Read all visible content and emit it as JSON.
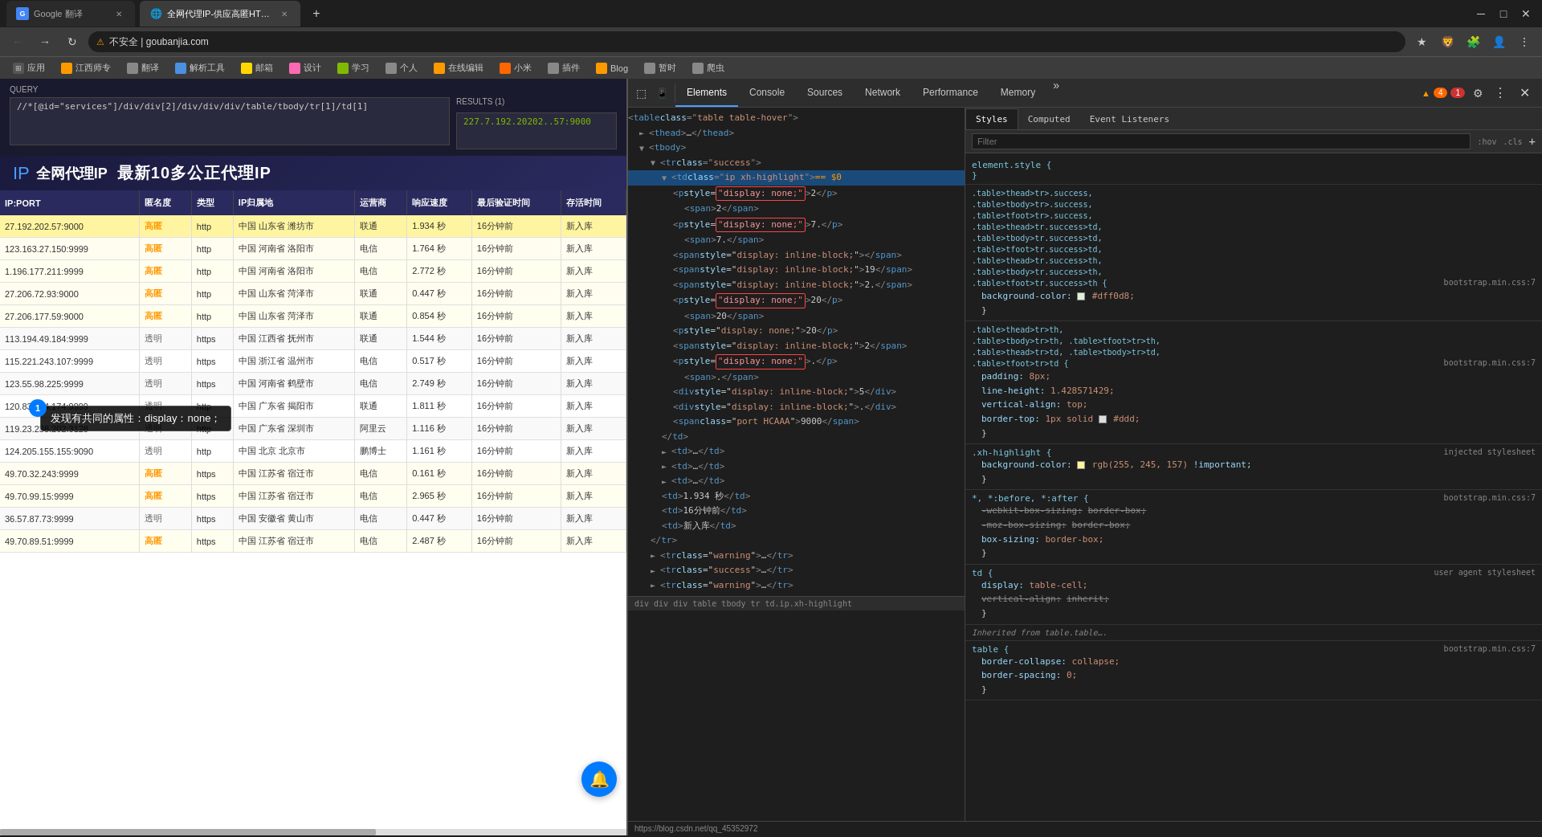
{
  "browser": {
    "tabs": [
      {
        "id": "tab1",
        "title": "Google 翻译",
        "active": false,
        "favicon": "G"
      },
      {
        "id": "tab2",
        "title": "全网代理IP-供应高匿HTTP代理...",
        "active": true,
        "favicon": "🌐"
      }
    ],
    "address": "不安全 | goubanjia.com",
    "bookmarks": [
      "应用",
      "江西师专",
      "翻译",
      "解析工具",
      "邮箱",
      "设计",
      "学习",
      "个人",
      "在线编辑",
      "小米",
      "插件",
      "Blog",
      "暂时",
      "爬虫"
    ]
  },
  "query": {
    "label": "QUERY",
    "input": "//*[@id=\"services\"]/div/div[2]/div/div/div/table/tbody/tr[1]/td[1]",
    "results_label": "RESULTS (1)",
    "result_value": "227.7.192.20202..57:9000"
  },
  "page": {
    "logo": "全网代理IP",
    "title": "最新10多公正代理IP"
  },
  "table": {
    "headers": [
      "IP:PORT",
      "匿名度",
      "类型",
      "IP归属地",
      "运营商",
      "响应速度",
      "最后验证时间",
      "存活时间"
    ],
    "rows": [
      {
        "ip": "27.192.202.57:9000",
        "anon": "高匿",
        "type": "http",
        "location": "中国 山东省 潍坊市",
        "isp": "联通",
        "speed": "1.934 秒",
        "time": "16分钟前",
        "alive": "新入库",
        "highlight": true
      },
      {
        "ip": "123.163.27.150:9999",
        "anon": "高匿",
        "type": "http",
        "location": "中国 河南省 洛阳市",
        "isp": "电信",
        "speed": "1.764 秒",
        "time": "16分钟前",
        "alive": "新入库",
        "highlight": false
      },
      {
        "ip": "1.196.177.211:9999",
        "anon": "高匿",
        "type": "http",
        "location": "中国 河南省 洛阳市",
        "isp": "电信",
        "speed": "2.772 秒",
        "time": "16分钟前",
        "alive": "新入库",
        "highlight": false
      },
      {
        "ip": "27.206.72.93:9000",
        "anon": "高匿",
        "type": "http",
        "location": "中国 山东省 菏泽市",
        "isp": "联通",
        "speed": "0.447 秒",
        "time": "16分钟前",
        "alive": "新入库",
        "highlight": false
      },
      {
        "ip": "27.206.177.59:9000",
        "anon": "高匿",
        "type": "http",
        "location": "中国 山东省 菏泽市",
        "isp": "联通",
        "speed": "0.854 秒",
        "time": "16分钟前",
        "alive": "新入库",
        "highlight": false
      },
      {
        "ip": "113.194.49.184:9999",
        "anon": "透明",
        "type": "https",
        "location": "中国 江西省 抚州市",
        "isp": "联通",
        "speed": "1.544 秒",
        "time": "16分钟前",
        "alive": "新入库",
        "highlight": false
      },
      {
        "ip": "115.221.243.107:9999",
        "anon": "透明",
        "type": "https",
        "location": "中国 浙江省 温州市",
        "isp": "电信",
        "speed": "0.517 秒",
        "time": "16分钟前",
        "alive": "新入库",
        "highlight": false
      },
      {
        "ip": "123.55.98.225:9999",
        "anon": "透明",
        "type": "https",
        "location": "中国 河南省 鹤壁市",
        "isp": "电信",
        "speed": "2.749 秒",
        "time": "16分钟前",
        "alive": "新入库",
        "highlight": false
      },
      {
        "ip": "120.83.104.174:9999",
        "anon": "透明",
        "type": "http",
        "location": "中国 广东省 揭阳市",
        "isp": "联通",
        "speed": "1.811 秒",
        "time": "16分钟前",
        "alive": "新入库",
        "highlight": false
      },
      {
        "ip": "119.23.238.202:3128",
        "anon": "透明",
        "type": "http",
        "location": "中国 广东省 深圳市",
        "isp": "阿里云",
        "speed": "1.116 秒",
        "time": "16分钟前",
        "alive": "新入库",
        "highlight": false
      },
      {
        "ip": "124.205.155.155:9090",
        "anon": "透明",
        "type": "http",
        "location": "中国 北京 北京市",
        "isp": "鹏博士",
        "speed": "1.161 秒",
        "time": "16分钟前",
        "alive": "新入库",
        "highlight": false
      },
      {
        "ip": "49.70.32.243:9999",
        "anon": "高匿",
        "type": "https",
        "location": "中国 江苏省 宿迁市",
        "isp": "电信",
        "speed": "0.161 秒",
        "time": "16分钟前",
        "alive": "新入库",
        "highlight": false
      },
      {
        "ip": "49.70.99.15:9999",
        "anon": "高匿",
        "type": "https",
        "location": "中国 江苏省 宿迁市",
        "isp": "电信",
        "speed": "2.965 秒",
        "time": "16分钟前",
        "alive": "新入库",
        "highlight": false
      },
      {
        "ip": "36.57.87.73:9999",
        "anon": "透明",
        "type": "https",
        "location": "中国 安徽省 黄山市",
        "isp": "电信",
        "speed": "0.447 秒",
        "time": "16分钟前",
        "alive": "新入库",
        "highlight": false
      },
      {
        "ip": "49.70.89.51:9999",
        "anon": "高匿",
        "type": "https",
        "location": "中国 江苏省 宿迁市",
        "isp": "电信",
        "speed": "2.487 秒",
        "time": "16分钟前",
        "alive": "新入库",
        "highlight": false
      }
    ]
  },
  "devtools": {
    "tabs": [
      "Elements",
      "Console",
      "Sources",
      "Network",
      "Performance",
      "Memory"
    ],
    "active_tab": "Elements",
    "more_label": "»",
    "badge_warn": "4",
    "badge_err": "1",
    "styles_tabs": [
      "Styles",
      "Computed",
      "Event Listeners"
    ],
    "active_styles_tab": "Styles",
    "filter_placeholder": "Filter",
    "filter_pseudo": ":hov",
    "filter_cls": ".cls",
    "filter_plus": "+",
    "dom": {
      "lines": [
        {
          "indent": 0,
          "content": "<table class=\"table table-hover\">",
          "type": "open"
        },
        {
          "indent": 2,
          "content": "► <thead>…</thead>",
          "type": "collapsed"
        },
        {
          "indent": 2,
          "content": "▼ <tbody>",
          "type": "open"
        },
        {
          "indent": 4,
          "content": "▼ <tr class=\"success\">",
          "type": "open"
        },
        {
          "indent": 6,
          "content": "▼ <td class=\"ip xh-highlight\"> == $0",
          "type": "selected"
        },
        {
          "indent": 8,
          "content": "<p style=\"display: none;\">2</p>",
          "type": "highlight1"
        },
        {
          "indent": 10,
          "content": "<span>2</span>",
          "type": "normal"
        },
        {
          "indent": 8,
          "content": "<p style=\"display: none;\">7.</p>",
          "type": "highlight2"
        },
        {
          "indent": 10,
          "content": "<span>7.</span>",
          "type": "normal"
        },
        {
          "indent": 8,
          "content": "<span style=\"display: inline-block;\"></span>",
          "type": "normal"
        },
        {
          "indent": 8,
          "content": "<span style=\"display: inline-block;\">19</span>",
          "type": "normal"
        },
        {
          "indent": 8,
          "content": "<span style=\"display: inline-block;\">2.</span>",
          "type": "normal"
        },
        {
          "indent": 8,
          "content": "<p style=\"display: none;\">20</p>",
          "type": "highlight3"
        },
        {
          "indent": 10,
          "content": "<span>20</span>",
          "type": "normal"
        },
        {
          "indent": 8,
          "content": "<p style=\"display: none;\">20</p>",
          "type": "normal"
        },
        {
          "indent": 8,
          "content": "<span style=\"display: inline-block;\">2</span>",
          "type": "normal"
        },
        {
          "indent": 8,
          "content": "<p style=\"display: none;\">.</p>",
          "type": "highlight4"
        },
        {
          "indent": 10,
          "content": "<span>.</span>",
          "type": "normal"
        },
        {
          "indent": 8,
          "content": "<div style=\"display: inline-block;\">5</div>",
          "type": "normal"
        },
        {
          "indent": 8,
          "content": "<div style=\"display: inline-block;\">.</div>",
          "type": "normal"
        },
        {
          "indent": 8,
          "content": "<span class=\"port HCAAA\">9000</span>",
          "type": "normal"
        },
        {
          "indent": 6,
          "content": "</td>",
          "type": "close"
        },
        {
          "indent": 6,
          "content": "► <td>…</td>",
          "type": "collapsed"
        },
        {
          "indent": 6,
          "content": "► <td>…</td>",
          "type": "collapsed"
        },
        {
          "indent": 6,
          "content": "► <td>…</td>",
          "type": "collapsed"
        },
        {
          "indent": 6,
          "content": "<td>1.934 秒</td>",
          "type": "normal"
        },
        {
          "indent": 6,
          "content": "<td>16分钟前</td>",
          "type": "normal"
        },
        {
          "indent": 6,
          "content": "<td>新入库</td>",
          "type": "normal"
        },
        {
          "indent": 4,
          "content": "</tr>",
          "type": "close"
        },
        {
          "indent": 4,
          "content": "► <tr class=\"warning\">…</tr>",
          "type": "collapsed"
        },
        {
          "indent": 4,
          "content": "► <tr class=\"success\">…</tr>",
          "type": "collapsed"
        },
        {
          "indent": 4,
          "content": "► <tr class=\"warning\">…</tr>",
          "type": "collapsed"
        }
      ]
    },
    "breadcrumb": "div  div  div  table  tbody  tr  td.ip.xh-highlight",
    "status_url": "https://blog.csdn.net/qq_45352972",
    "styles": {
      "element_style": {
        "selector": "element.style {",
        "rules": []
      },
      "blocks": [
        {
          "selector": ".table>thead>tr>.success,\n.table>tbody>tr>.success,\n.table>tfoot>tr>.success,\n.table>thead>tr.success>td,\n.table>tbody>tr.success>td,\n.table>tfoot>tr.success>td,\n.table>thead>tr.success>th,\n.table>tbody>tr.success>th,\n.table>tfoot>tr.success>th {",
          "source": "bootstrap.min.css:7",
          "rules": [
            {
              "prop": "background-color:",
              "val": "#dff0d8;",
              "color": "#dff0d8"
            }
          ]
        },
        {
          "selector": ".table>thead>tr>th,\n.table>tbody>tr>th, .table>tfoot>tr>th,\n.table>thead>tr>td, .table>tbody>tr>td,\n.table>tfoot>tr>td {",
          "source": "bootstrap.min.css:7",
          "rules": [
            {
              "prop": "padding:",
              "val": "8px;"
            },
            {
              "prop": "line-height:",
              "val": "1.428571429;"
            },
            {
              "prop": "vertical-align:",
              "val": "top;"
            },
            {
              "prop": "border-top:",
              "val": "1px solid",
              "color": "#ddd",
              "val2": ";"
            }
          ]
        },
        {
          "selector": ".xh-highlight {",
          "source": "injected stylesheet",
          "rules": [
            {
              "prop": "background-color:",
              "val": "rgb(255, 245, 157)",
              "color": "rgb(255,245,157)",
              "extra": "!important;"
            }
          ]
        },
        {
          "selector": "*, *:before, *:after {",
          "source": "bootstrap.min.css:7",
          "rules": [
            {
              "prop": "-webkit-box-sizing:",
              "val": "border-box;",
              "strikethrough": true
            },
            {
              "prop": "-moz-box-sizing:",
              "val": "border-box;",
              "strikethrough": true
            },
            {
              "prop": "box-sizing:",
              "val": "border-box;"
            }
          ]
        },
        {
          "selector": "td {",
          "source": "user agent stylesheet",
          "rules": [
            {
              "prop": "display:",
              "val": "table-cell;"
            },
            {
              "prop": "vertical-align:",
              "val": "inherit;",
              "strikethrough": true
            }
          ]
        },
        {
          "selector_inherited": "Inherited from table.table….",
          "selector": "table {",
          "source": "bootstrap.min.css:7",
          "rules": [
            {
              "prop": "border-collapse:",
              "val": "collapse;"
            },
            {
              "prop": "border-spacing:",
              "val": "0;"
            }
          ]
        }
      ]
    }
  },
  "annotation": {
    "tooltip": "发现有共同的属性：display：none；",
    "badge": "1"
  }
}
